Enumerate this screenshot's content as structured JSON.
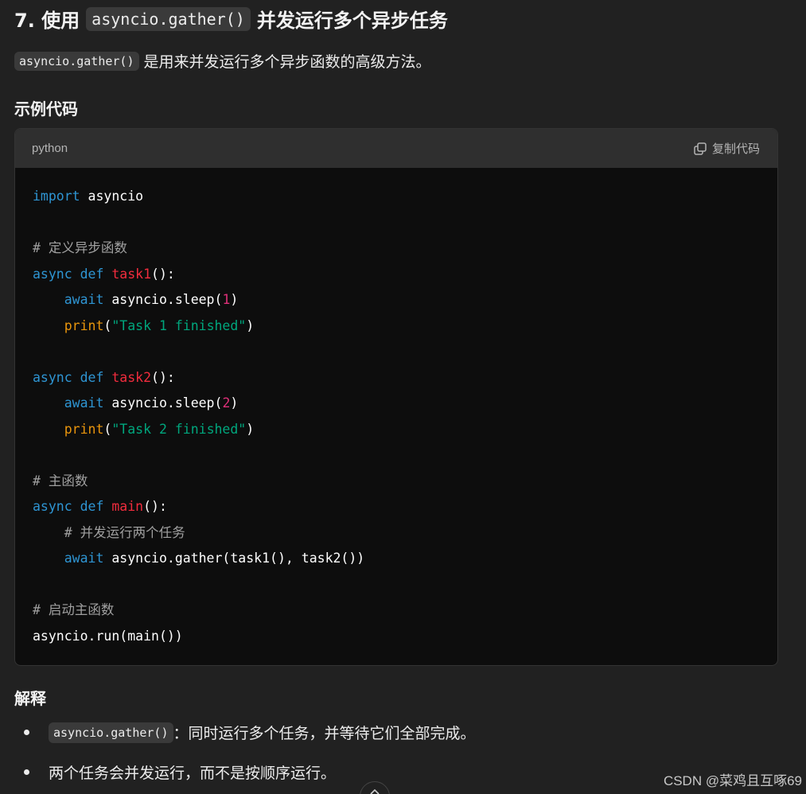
{
  "heading": {
    "prefix": "7. 使用",
    "code": "asyncio.gather()",
    "suffix": "并发运行多个异步任务"
  },
  "intro": {
    "code": "asyncio.gather()",
    "text": "是用来并发运行多个异步函数的高级方法。"
  },
  "example_title": "示例代码",
  "code_block": {
    "language": "python",
    "copy_label": "复制代码",
    "lines": [
      [
        {
          "t": "import",
          "c": "kw"
        },
        {
          "t": " asyncio"
        }
      ],
      [],
      [
        {
          "t": "# 定义异步函数",
          "c": "cm"
        }
      ],
      [
        {
          "t": "async",
          "c": "kw"
        },
        {
          "t": " "
        },
        {
          "t": "def",
          "c": "kw"
        },
        {
          "t": " "
        },
        {
          "t": "task1",
          "c": "fn"
        },
        {
          "t": "():"
        }
      ],
      [
        {
          "t": "    "
        },
        {
          "t": "await",
          "c": "kw"
        },
        {
          "t": " asyncio.sleep("
        },
        {
          "t": "1",
          "c": "num"
        },
        {
          "t": ")"
        }
      ],
      [
        {
          "t": "    "
        },
        {
          "t": "print",
          "c": "bi"
        },
        {
          "t": "("
        },
        {
          "t": "\"Task 1 finished\"",
          "c": "str"
        },
        {
          "t": ")"
        }
      ],
      [],
      [
        {
          "t": "async",
          "c": "kw"
        },
        {
          "t": " "
        },
        {
          "t": "def",
          "c": "kw"
        },
        {
          "t": " "
        },
        {
          "t": "task2",
          "c": "fn"
        },
        {
          "t": "():"
        }
      ],
      [
        {
          "t": "    "
        },
        {
          "t": "await",
          "c": "kw"
        },
        {
          "t": " asyncio.sleep("
        },
        {
          "t": "2",
          "c": "num"
        },
        {
          "t": ")"
        }
      ],
      [
        {
          "t": "    "
        },
        {
          "t": "print",
          "c": "bi"
        },
        {
          "t": "("
        },
        {
          "t": "\"Task 2 finished\"",
          "c": "str"
        },
        {
          "t": ")"
        }
      ],
      [],
      [
        {
          "t": "# 主函数",
          "c": "cm"
        }
      ],
      [
        {
          "t": "async",
          "c": "kw"
        },
        {
          "t": " "
        },
        {
          "t": "def",
          "c": "kw"
        },
        {
          "t": " "
        },
        {
          "t": "main",
          "c": "fn"
        },
        {
          "t": "():"
        }
      ],
      [
        {
          "t": "    "
        },
        {
          "t": "# 并发运行两个任务",
          "c": "cm"
        }
      ],
      [
        {
          "t": "    "
        },
        {
          "t": "await",
          "c": "kw"
        },
        {
          "t": " asyncio.gather(task1(), task2())"
        }
      ],
      [],
      [
        {
          "t": "# 启动主函数",
          "c": "cm"
        }
      ],
      [
        {
          "t": "asyncio.run(main())"
        }
      ]
    ]
  },
  "explanation_title": "解释",
  "bullets": [
    {
      "code": "asyncio.gather()",
      "text": "：同时运行多个任务，并等待它们全部完成。"
    },
    {
      "code": "",
      "text": "两个任务会并发运行，而不是按顺序运行。"
    }
  ],
  "watermark": "CSDN @菜鸡且互啄69",
  "colors": {
    "background": "#212121",
    "code_background": "#0d0d0d",
    "code_header": "#2f2f2f",
    "keyword": "#2e95d3",
    "function_name": "#f22c3d",
    "number": "#df3079",
    "string": "#00a67d",
    "builtin": "#e9950c",
    "comment": "#a0a0a0"
  },
  "icons": {
    "copy": "copy-icon",
    "scroll_down": "arrow-down-icon"
  }
}
